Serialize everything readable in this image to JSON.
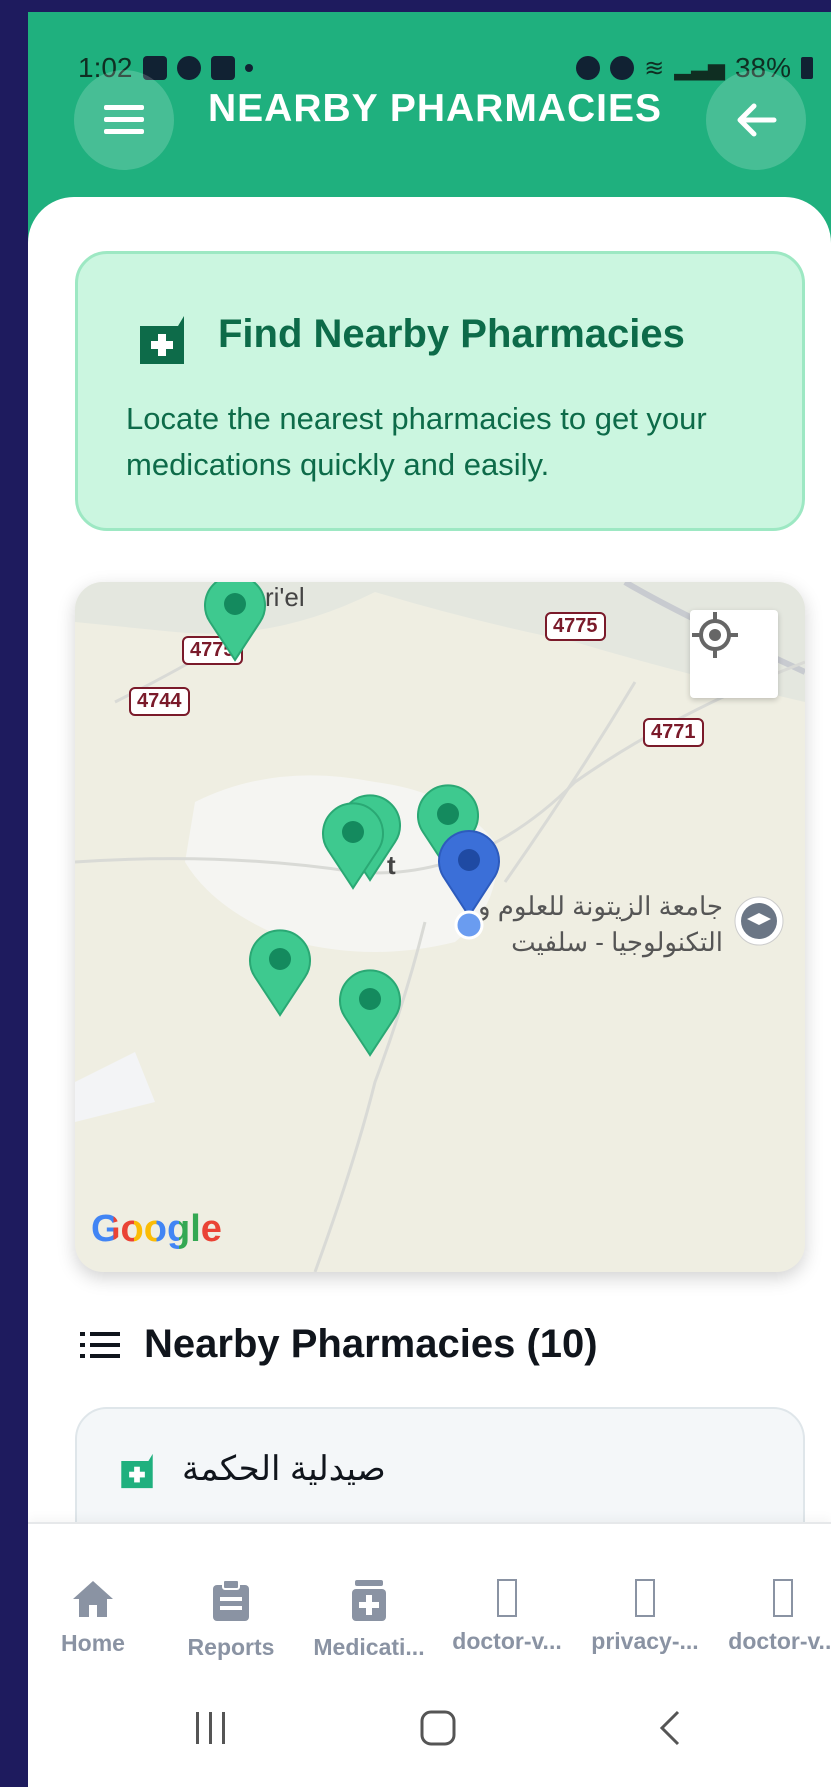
{
  "status_bar": {
    "time": "1:02",
    "battery": "38%"
  },
  "header": {
    "title": "NEARBY PHARMACIES",
    "menu_icon": "hamburger-icon",
    "back_icon": "arrow-left-icon"
  },
  "info_card": {
    "title": "Find Nearby Pharmacies",
    "description": "Locate the nearest pharmacies to get your medications quickly and easily.",
    "icon": "pharmacy-icon"
  },
  "map": {
    "road_labels": [
      "4775",
      "4775",
      "4744",
      "4771"
    ],
    "place_label_1": "ri'el",
    "place_label_2": "t",
    "poi_label": "جامعة الزيتونة للعلوم و التكنولوجيا - سلفيت",
    "attribution": "Google",
    "pharmacy_marker_count": 6,
    "colors": {
      "pharmacy_marker": "#3ec98f",
      "user_marker": "#3b6fd8"
    }
  },
  "list": {
    "title": "Nearby Pharmacies (10)",
    "icon": "list-icon"
  },
  "pharmacies": [
    {
      "name": "صيدلية الحكمة"
    }
  ],
  "bottom_nav": [
    {
      "label": "Home",
      "icon": "home-icon"
    },
    {
      "label": "Reports",
      "icon": "clipboard-icon"
    },
    {
      "label": "Medicati...",
      "icon": "medication-icon"
    },
    {
      "label": "doctor-v...",
      "icon": "missing-icon"
    },
    {
      "label": "privacy-...",
      "icon": "missing-icon"
    },
    {
      "label": "doctor-v...",
      "icon": "missing-icon"
    }
  ],
  "colors": {
    "primary": "#1fb07e",
    "accent_text": "#0d6b49",
    "card_bg": "#cbf6e0"
  }
}
